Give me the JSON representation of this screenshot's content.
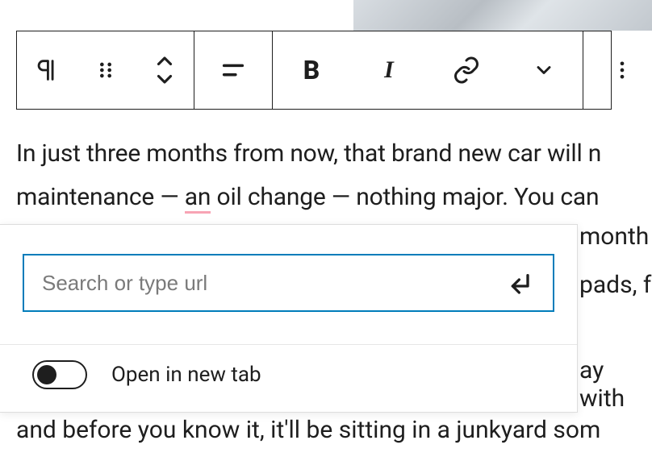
{
  "toolbar": {
    "block_type_icon": "paragraph-icon",
    "drag_icon": "drag-handle-icon",
    "move_icon": "move-up-down-icon",
    "align_icon": "align-left-icon",
    "bold_label": "B",
    "italic_label": "I",
    "link_icon": "link-icon",
    "more_rich_icon": "chevron-down-icon",
    "options_icon": "more-options-icon"
  },
  "content": {
    "line1": "In just three months from now, that brand new car will n",
    "line2_pre": "maintenance — ",
    "line2_an": "an",
    "line2_post": " oil change — nothing major. You can",
    "frag_months": "month",
    "frag_pads": "pads, f",
    "frag_ay": "ay with",
    "bottom": "and before you know it, it'll be sitting in a junkyard som"
  },
  "link_panel": {
    "placeholder": "Search or type url",
    "value": "",
    "submit_icon": "enter-icon",
    "toggle_label": "Open in new tab",
    "toggle_state": false
  }
}
